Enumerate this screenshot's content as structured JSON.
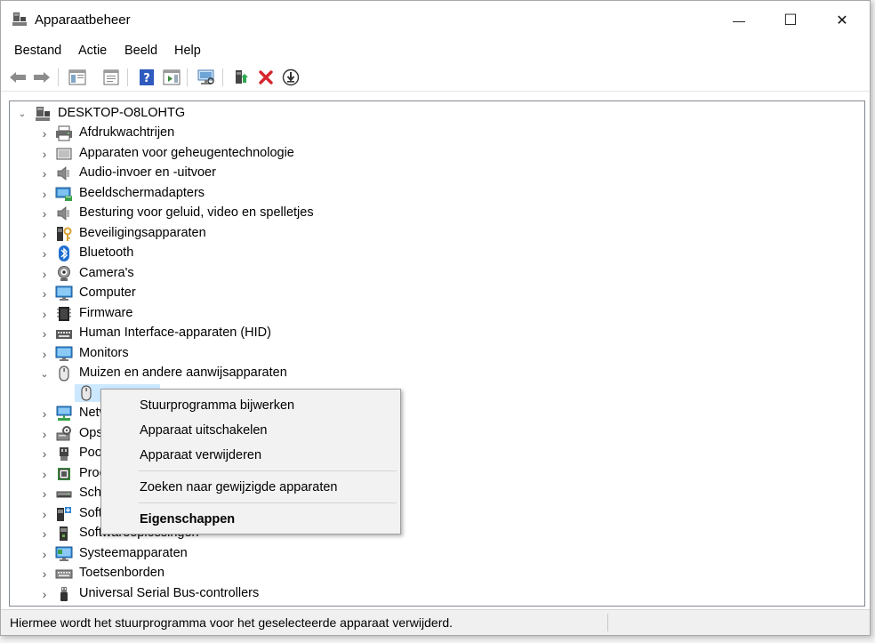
{
  "window": {
    "title": "Apparaatbeheer",
    "minimize_glyph": "—",
    "maximize_glyph": "☐",
    "close_glyph": "✕"
  },
  "menubar": {
    "items": [
      {
        "label": "Bestand"
      },
      {
        "label": "Actie"
      },
      {
        "label": "Beeld"
      },
      {
        "label": "Help"
      }
    ]
  },
  "toolbar": {
    "buttons": [
      {
        "icon": "back-arrow-icon"
      },
      {
        "icon": "forward-arrow-icon"
      },
      {
        "icon": "show-hide-console-tree-icon"
      },
      {
        "icon": "properties-icon"
      },
      {
        "icon": "help-icon"
      },
      {
        "icon": "action-pane-icon"
      },
      {
        "icon": "scan-hardware-icon"
      },
      {
        "icon": "update-driver-icon"
      },
      {
        "icon": "uninstall-device-icon"
      },
      {
        "icon": "disable-device-icon"
      }
    ]
  },
  "tree": {
    "root": {
      "label": "DESKTOP-O8LOHTG",
      "expanded": true
    },
    "categories": [
      {
        "label": "Afdrukwachtrijen",
        "icon": "printer-icon"
      },
      {
        "label": "Apparaten voor geheugentechnologie",
        "icon": "memory-device-icon"
      },
      {
        "label": "Audio-invoer en -uitvoer",
        "icon": "speaker-icon"
      },
      {
        "label": "Beeldschermadapters",
        "icon": "display-adapter-icon"
      },
      {
        "label": "Besturing voor geluid, video en spelletjes",
        "icon": "speaker-icon"
      },
      {
        "label": "Beveiligingsapparaten",
        "icon": "security-key-icon"
      },
      {
        "label": "Bluetooth",
        "icon": "bluetooth-icon"
      },
      {
        "label": "Camera's",
        "icon": "webcam-icon"
      },
      {
        "label": "Computer",
        "icon": "computer-icon"
      },
      {
        "label": "Firmware",
        "icon": "firmware-chip-icon"
      },
      {
        "label": "Human Interface-apparaten (HID)",
        "icon": "keyboard-hid-icon"
      },
      {
        "label": "Monitors",
        "icon": "monitor-icon"
      },
      {
        "label": "Muizen en andere aanwijsapparaten",
        "icon": "mouse-icon",
        "expanded": true
      },
      {
        "label": "Netw",
        "icon": "network-adapter-icon"
      },
      {
        "label": "Ops",
        "icon": "storage-controller-icon"
      },
      {
        "label": "Poo",
        "icon": "port-icon"
      },
      {
        "label": "Proc",
        "icon": "processor-icon"
      },
      {
        "label": "Schi",
        "icon": "disk-drive-icon"
      },
      {
        "label": "Soft",
        "icon": "software-device-icon"
      },
      {
        "label": "Softwareoplossingen",
        "icon": "software-component-icon"
      },
      {
        "label": "Systeemapparaten",
        "icon": "system-device-icon"
      },
      {
        "label": "Toetsenborden",
        "icon": "keyboard-icon"
      },
      {
        "label": "Universal Serial Bus-controllers",
        "icon": "usb-icon"
      }
    ]
  },
  "context_menu": {
    "items": [
      {
        "label": "Stuurprogramma bijwerken"
      },
      {
        "label": "Apparaat uitschakelen"
      },
      {
        "label": "Apparaat verwijderen"
      },
      {
        "label": "Zoeken naar gewijzigde apparaten"
      },
      {
        "label": "Eigenschappen"
      }
    ]
  },
  "statusbar": {
    "text": "Hiermee wordt het stuurprogramma voor het geselecteerde apparaat verwijderd."
  }
}
